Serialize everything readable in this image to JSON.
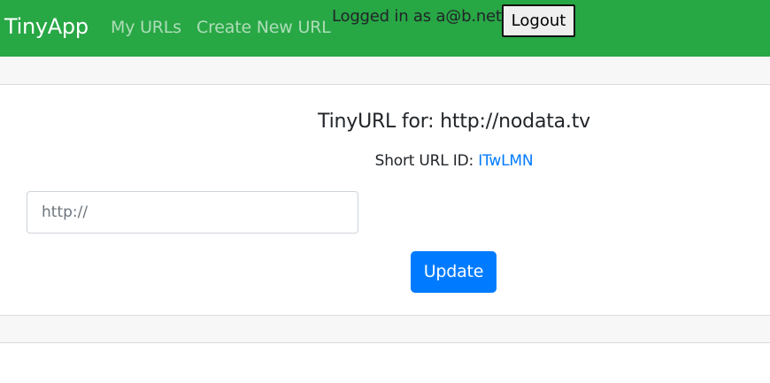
{
  "navbar": {
    "brand": "TinyApp",
    "links": [
      "My URLs",
      "Create New URL"
    ],
    "logged_in_text": "Logged in as a@b.net",
    "logout_label": "Logout",
    "background_color": "#28a745"
  },
  "card": {
    "title": "TinyURL for: http://nodata.tv",
    "short_url_label": "Short URL ID:",
    "short_url_id": "ITwLMN",
    "url_input": {
      "value": "",
      "placeholder": "http://"
    },
    "update_label": "Update",
    "accent_color": "#007bff"
  }
}
